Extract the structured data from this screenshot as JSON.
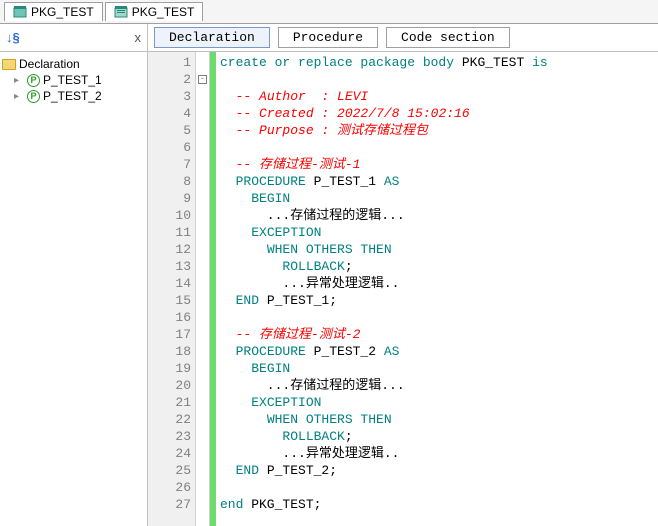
{
  "tabs": {
    "t1": "PKG_TEST",
    "t2": "PKG_TEST"
  },
  "tree": {
    "root": "Declaration",
    "items": [
      {
        "label": "P_TEST_1"
      },
      {
        "label": "P_TEST_2"
      }
    ]
  },
  "nav": {
    "declaration": "Declaration",
    "procedure": "Procedure",
    "codesection": "Code section"
  },
  "sort_label": "↓§",
  "close_label": "x",
  "code": {
    "lines": [
      {
        "n": 1,
        "seg": [
          {
            "c": "kw",
            "t": "create or replace package body"
          },
          {
            "c": "txt",
            "t": " PKG_TEST "
          },
          {
            "c": "kw",
            "t": "is"
          }
        ]
      },
      {
        "n": 2,
        "seg": []
      },
      {
        "n": 3,
        "seg": [
          {
            "c": "txt",
            "t": "  "
          },
          {
            "c": "cmt",
            "t": "-- Author  : LEVI"
          }
        ]
      },
      {
        "n": 4,
        "seg": [
          {
            "c": "txt",
            "t": "  "
          },
          {
            "c": "cmt",
            "t": "-- Created : 2022/7/8 15:02:16"
          }
        ]
      },
      {
        "n": 5,
        "seg": [
          {
            "c": "txt",
            "t": "  "
          },
          {
            "c": "cmt",
            "t": "-- Purpose : 测试存储过程包"
          }
        ]
      },
      {
        "n": 6,
        "seg": []
      },
      {
        "n": 7,
        "seg": [
          {
            "c": "txt",
            "t": "  "
          },
          {
            "c": "cmt",
            "t": "-- 存储过程-测试-1"
          }
        ]
      },
      {
        "n": 8,
        "seg": [
          {
            "c": "txt",
            "t": "  "
          },
          {
            "c": "kw",
            "t": "PROCEDURE"
          },
          {
            "c": "txt",
            "t": " P_TEST_1 "
          },
          {
            "c": "kw",
            "t": "AS"
          }
        ]
      },
      {
        "n": 9,
        "seg": [
          {
            "c": "txt",
            "t": "    "
          },
          {
            "c": "kw",
            "t": "BEGIN"
          }
        ]
      },
      {
        "n": 10,
        "seg": [
          {
            "c": "txt",
            "t": "      ...存储过程的逻辑..."
          }
        ]
      },
      {
        "n": 11,
        "seg": [
          {
            "c": "txt",
            "t": "    "
          },
          {
            "c": "kw",
            "t": "EXCEPTION"
          }
        ]
      },
      {
        "n": 12,
        "seg": [
          {
            "c": "txt",
            "t": "      "
          },
          {
            "c": "kw",
            "t": "WHEN OTHERS THEN"
          }
        ]
      },
      {
        "n": 13,
        "seg": [
          {
            "c": "txt",
            "t": "        "
          },
          {
            "c": "kw",
            "t": "ROLLBACK"
          },
          {
            "c": "txt",
            "t": ";"
          }
        ]
      },
      {
        "n": 14,
        "seg": [
          {
            "c": "txt",
            "t": "        ...异常处理逻辑.."
          }
        ]
      },
      {
        "n": 15,
        "seg": [
          {
            "c": "txt",
            "t": "  "
          },
          {
            "c": "kw",
            "t": "END"
          },
          {
            "c": "txt",
            "t": " P_TEST_1;"
          }
        ]
      },
      {
        "n": 16,
        "seg": []
      },
      {
        "n": 17,
        "seg": [
          {
            "c": "txt",
            "t": "  "
          },
          {
            "c": "cmt",
            "t": "-- 存储过程-测试-2"
          }
        ]
      },
      {
        "n": 18,
        "seg": [
          {
            "c": "txt",
            "t": "  "
          },
          {
            "c": "kw",
            "t": "PROCEDURE"
          },
          {
            "c": "txt",
            "t": " P_TEST_2 "
          },
          {
            "c": "kw",
            "t": "AS"
          }
        ]
      },
      {
        "n": 19,
        "seg": [
          {
            "c": "txt",
            "t": "    "
          },
          {
            "c": "kw",
            "t": "BEGIN"
          }
        ]
      },
      {
        "n": 20,
        "seg": [
          {
            "c": "txt",
            "t": "      ...存储过程的逻辑..."
          }
        ]
      },
      {
        "n": 21,
        "seg": [
          {
            "c": "txt",
            "t": "    "
          },
          {
            "c": "kw",
            "t": "EXCEPTION"
          }
        ]
      },
      {
        "n": 22,
        "seg": [
          {
            "c": "txt",
            "t": "      "
          },
          {
            "c": "kw",
            "t": "WHEN OTHERS THEN"
          }
        ]
      },
      {
        "n": 23,
        "seg": [
          {
            "c": "txt",
            "t": "        "
          },
          {
            "c": "kw",
            "t": "ROLLBACK"
          },
          {
            "c": "txt",
            "t": ";"
          }
        ]
      },
      {
        "n": 24,
        "seg": [
          {
            "c": "txt",
            "t": "        ...异常处理逻辑.."
          }
        ]
      },
      {
        "n": 25,
        "seg": [
          {
            "c": "txt",
            "t": "  "
          },
          {
            "c": "kw",
            "t": "END"
          },
          {
            "c": "txt",
            "t": " P_TEST_2;"
          }
        ]
      },
      {
        "n": 26,
        "seg": []
      },
      {
        "n": 27,
        "seg": [
          {
            "c": "kw",
            "t": "end"
          },
          {
            "c": "txt",
            "t": " PKG_TEST;"
          }
        ]
      }
    ]
  }
}
